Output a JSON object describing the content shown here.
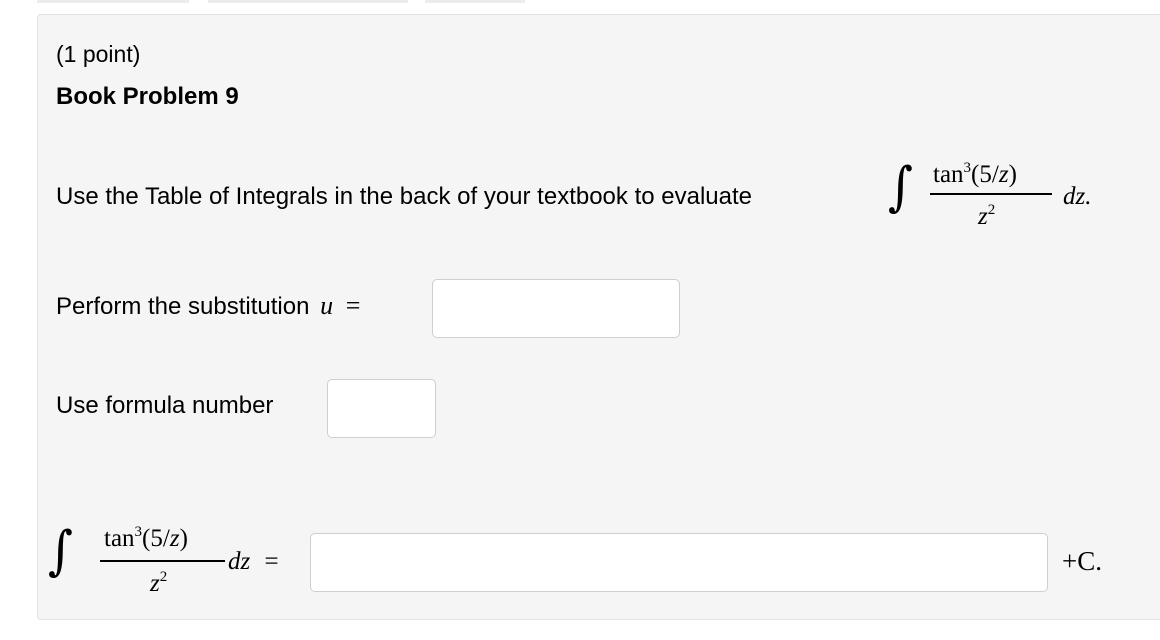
{
  "problem": {
    "points": "(1 point)",
    "title": "Book Problem 9",
    "prompt": "Use the Table of Integrals in the back of your textbook to evaluate",
    "integrand_numerator": "tan³(5/z)",
    "integrand_denominator": "z²",
    "differential": "dz.",
    "substitution_label": "Perform the substitution",
    "substitution_var": "u",
    "equals": "=",
    "formula_label": "Use formula number",
    "answer_differential": "dz",
    "answer_suffix": "+C."
  },
  "inputs": {
    "substitution_value": "",
    "formula_value": "",
    "antiderivative_value": ""
  }
}
